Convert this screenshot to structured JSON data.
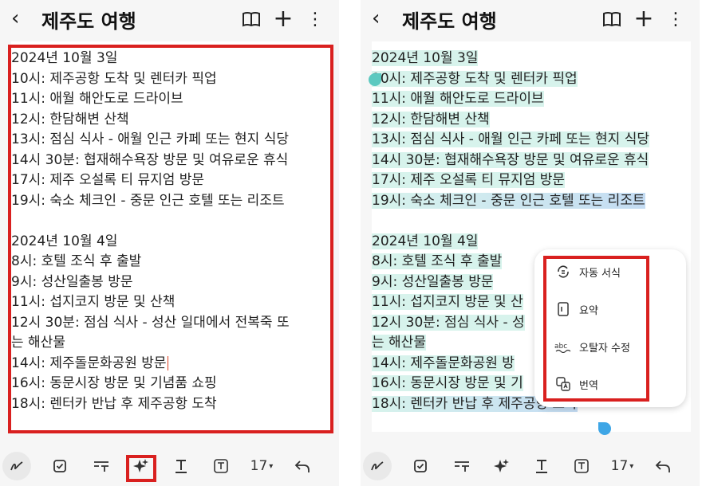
{
  "header": {
    "back_icon": "chevron-left-icon",
    "title": "제주도 여행",
    "icons": [
      "book-icon",
      "plus-icon",
      "more-vertical-icon"
    ]
  },
  "note": {
    "lines": [
      "2024년 10월 3일",
      "10시: 제주공항 도착 및 렌터카 픽업",
      "11시: 애월 해안도로 드라이브",
      "12시: 한담해변 산책",
      "13시: 점심 식사 - 애월 인근 카페 또는 현지 식당",
      "14시 30분: 협재해수욕장 방문 및 여유로운 휴식",
      "17시: 제주 오설록 티 뮤지엄 방문",
      "19시: 숙소 체크인 - 중문 인근 호텔 또는 리조트",
      "",
      "2024년 10월 4일",
      "8시: 호텔 조식 후 출발",
      "9시: 성산일출봉 방문",
      "11시: 섭지코지 방문 및 산책",
      "12시 30분: 점심 식사 - 성산 일대에서 전복죽 또",
      "는 해산물",
      "14시: 제주돌문화공원 방문",
      "16시: 동문시장 방문 및 기념품 쇼핑",
      "18시: 렌터카 반납 후 제주공항 도착"
    ]
  },
  "right_note": {
    "lines": [
      "2024년 10월 3일",
      "10시: 제주공항 도착 및 렌터카 픽업",
      "11시: 애월 해안도로 드라이브",
      "12시: 한담해변 산책",
      "13시: 점심 식사 - 애월 인근 카페 또는 현지 식당",
      "14시 30분: 협재해수욕장 방문 및 여유로운 휴식",
      "17시: 제주 오설록 티 뮤지엄 방문",
      "19시: 숙소 체크인 - 중문 인근 호텔 또는 리조트",
      "",
      "2024년 10월 4일",
      "8시: 호텔 조식 후 출발",
      "9시: 성산일출봉 방문",
      "11시: 섭지코지 방문 및 산",
      "12시 30분: 점심 식사 - 성",
      "는 해산물",
      "14시: 제주돌문화공원 방",
      "16시: 동문시장 방문 및 기",
      "18시: 렌터카 반납 후 제주공항 도착"
    ]
  },
  "toolbar": {
    "icons": [
      "pen-icon",
      "checkbox-icon",
      "text-format-icon",
      "ai-sparkle-icon",
      "text-style-icon",
      "text-box-icon"
    ],
    "font_size": "17",
    "dropdown_icon": "caret-down-icon",
    "undo_icon": "undo-icon"
  },
  "ai_menu": {
    "items": [
      {
        "label": "자동 서식",
        "icon": "auto-format-icon"
      },
      {
        "label": "요약",
        "icon": "summary-icon"
      },
      {
        "label": "오탈자 수정",
        "icon": "spellcheck-icon"
      },
      {
        "label": "번역",
        "icon": "translate-icon"
      }
    ]
  },
  "colors": {
    "highlight_red": "#d9201f",
    "selection_green": "#d7f3ec",
    "handle_blue": "#3ea6e6"
  }
}
